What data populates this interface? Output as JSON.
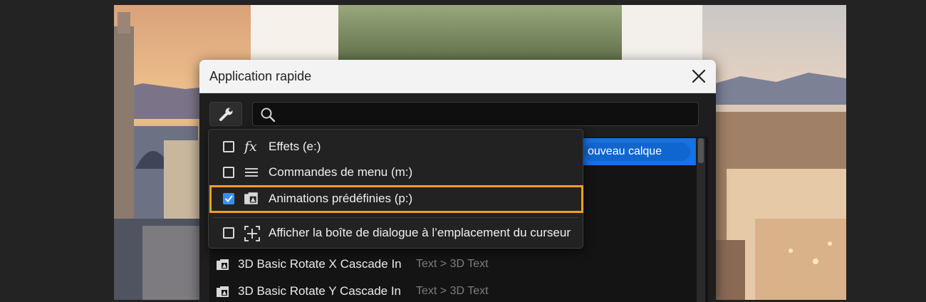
{
  "dialog": {
    "title": "Application rapide",
    "close_icon": "close-icon"
  },
  "toolbar": {
    "wrench_icon": "wrench-icon",
    "search_icon": "search-icon",
    "search_value": ""
  },
  "selected_result": {
    "label": "ouveau calque"
  },
  "menu": {
    "items": [
      {
        "label": "Effets (e:)",
        "icon": "fx-icon",
        "checked": false
      },
      {
        "label": "Commandes de menu (m:)",
        "icon": "menu-lines-icon",
        "checked": false
      },
      {
        "label": "Animations prédéfinies (p:)",
        "icon": "preset-icon",
        "checked": true
      },
      {
        "label": "Afficher la boîte de dialogue à l’emplacement du curseur",
        "icon": "cursor-target-icon",
        "checked": false
      }
    ]
  },
  "results": [
    {
      "name": "3D Basic Rotate X Cascade In",
      "path": "Text > 3D Text",
      "icon": "preset-icon"
    },
    {
      "name": "3D Basic Rotate Y Cascade In",
      "path": "Text > 3D Text",
      "icon": "preset-icon"
    }
  ],
  "colors": {
    "accent_blue": "#1473e6",
    "highlight_orange": "#f2a01e",
    "dialog_bg": "#1e1e1e",
    "titlebar_bg": "#f3f3f3"
  }
}
